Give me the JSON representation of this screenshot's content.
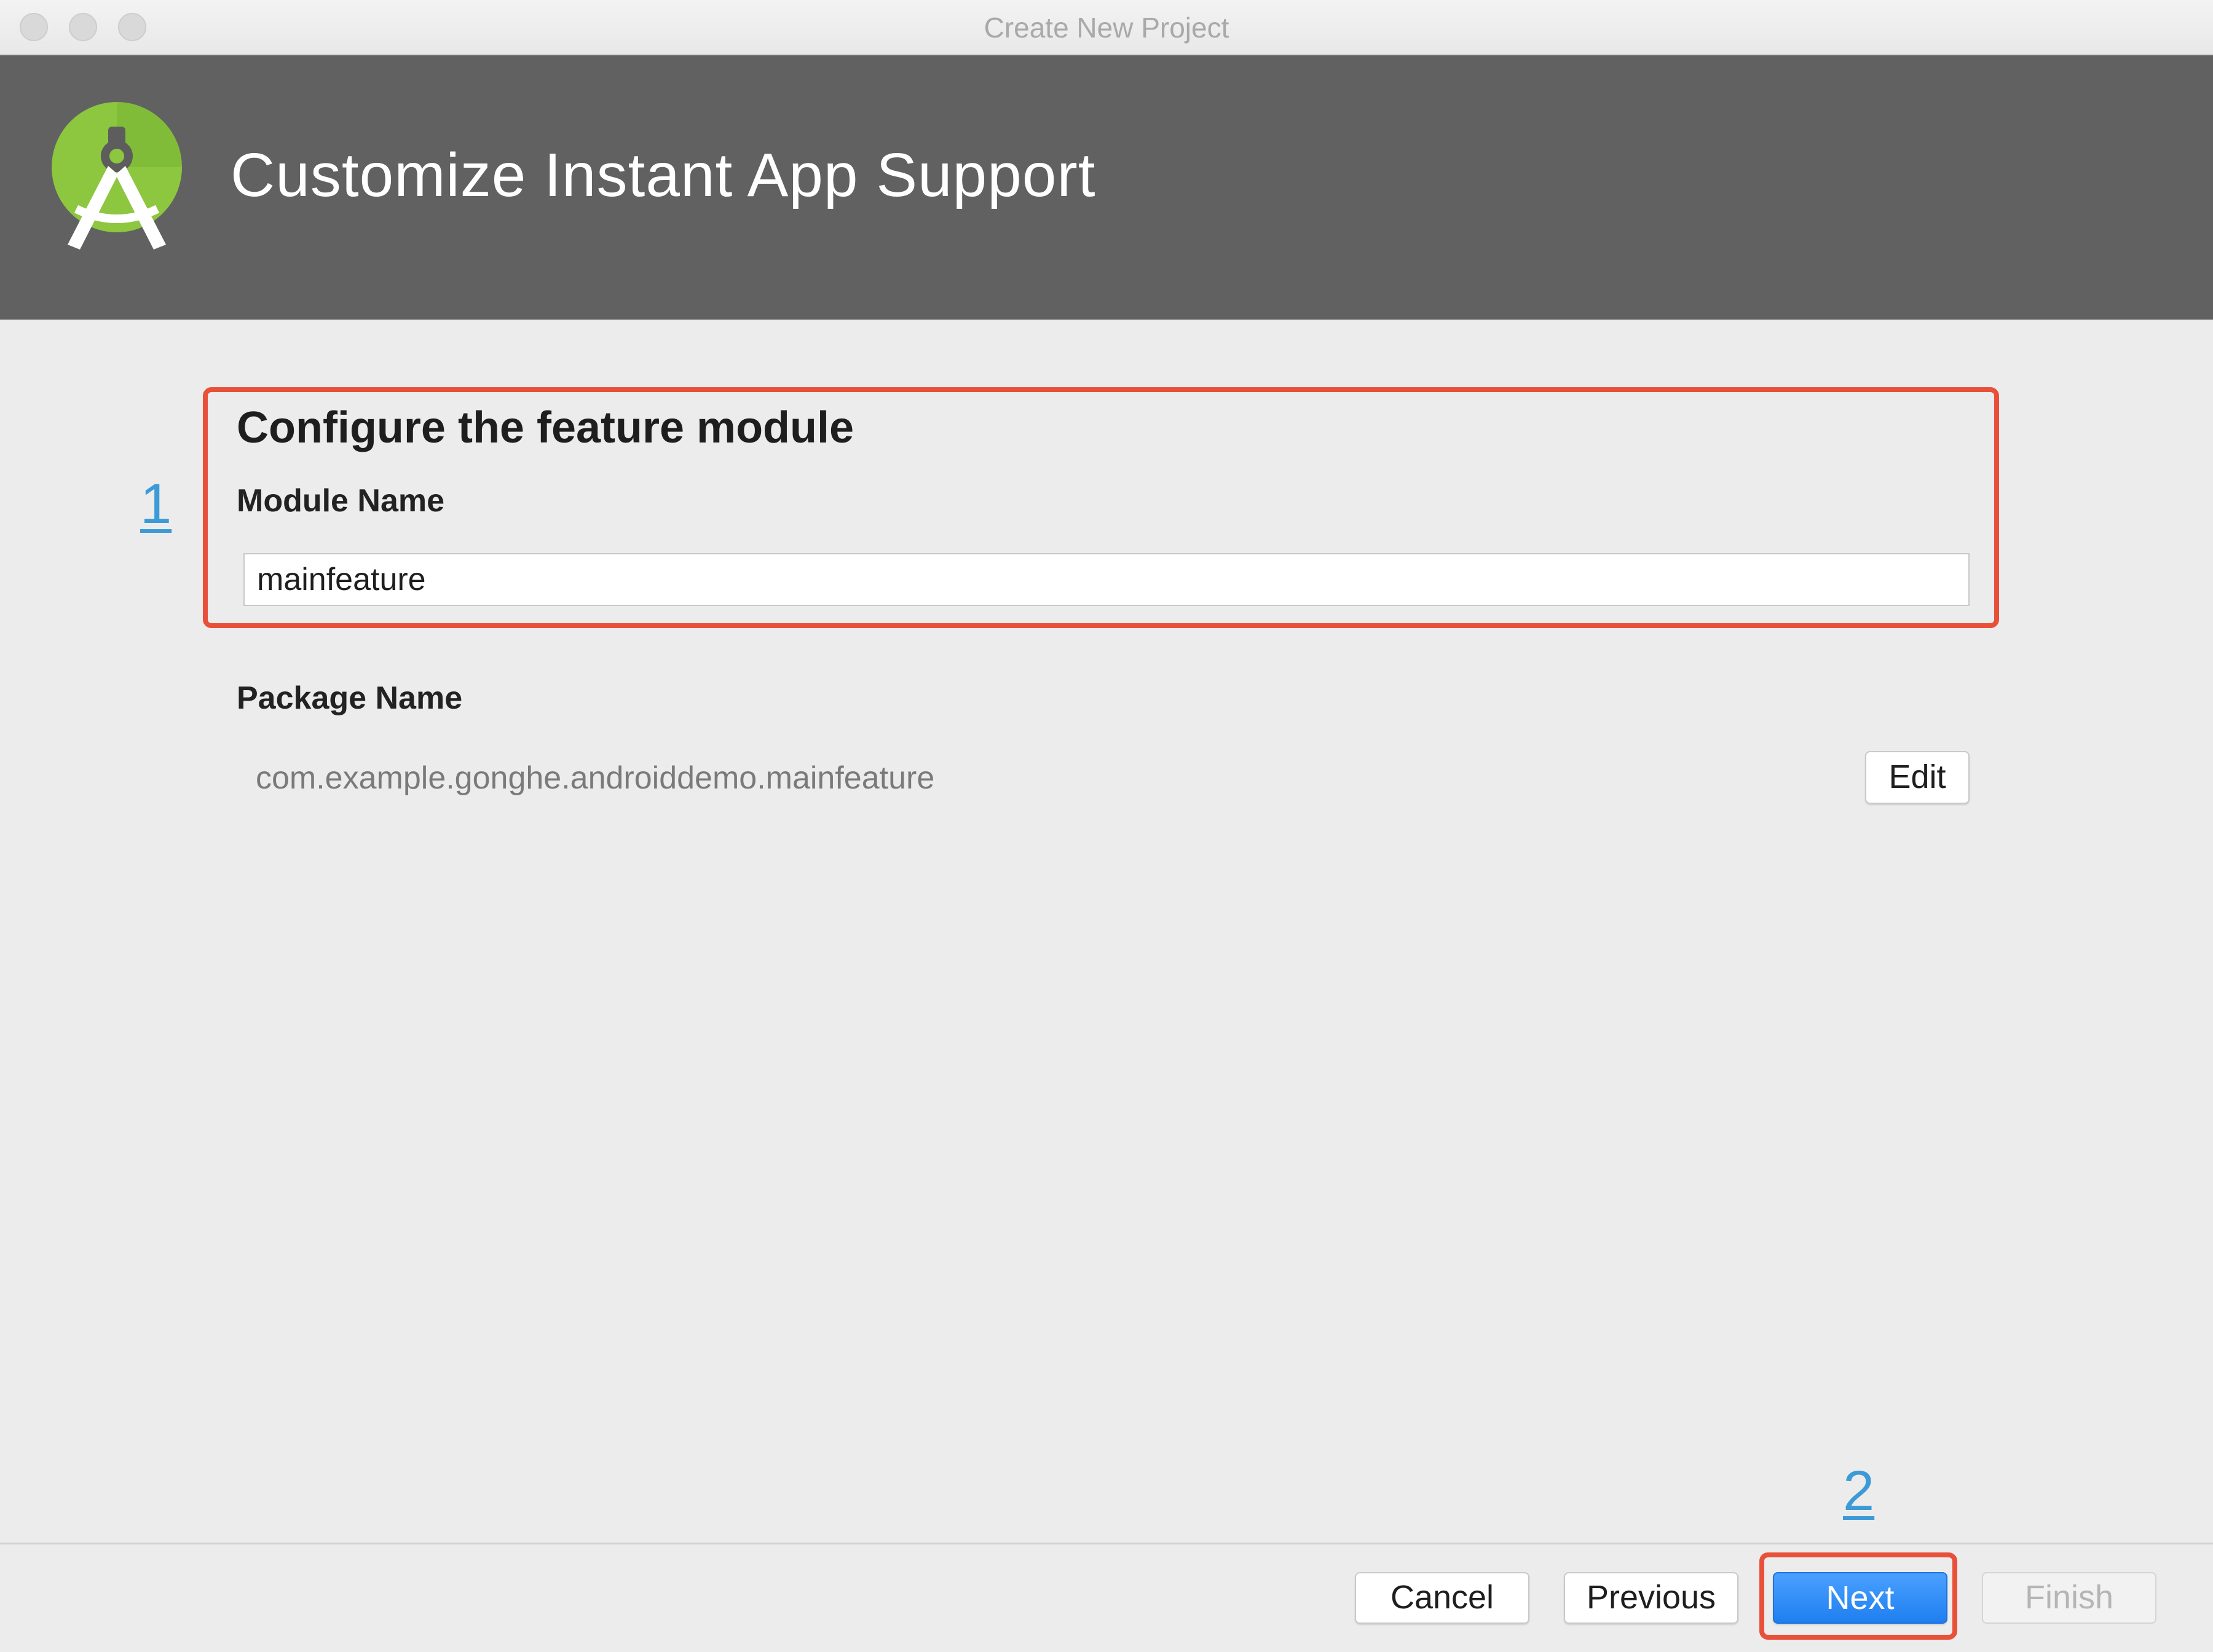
{
  "window": {
    "title": "Create New Project"
  },
  "header": {
    "title": "Customize Instant App Support",
    "logo_icon": "android-studio-logo-icon"
  },
  "annotations": {
    "step1": "1",
    "step2": "2",
    "highlight_color": "#e8503a",
    "number_color": "#3c9ad6"
  },
  "form": {
    "section_title": "Configure the feature module",
    "module_name_label": "Module Name",
    "module_name_value": "mainfeature",
    "package_name_label": "Package Name",
    "package_name_value": "com.example.gonghe.androiddemo.mainfeature",
    "edit_label": "Edit"
  },
  "footer": {
    "cancel_label": "Cancel",
    "previous_label": "Previous",
    "next_label": "Next",
    "finish_label": "Finish"
  }
}
